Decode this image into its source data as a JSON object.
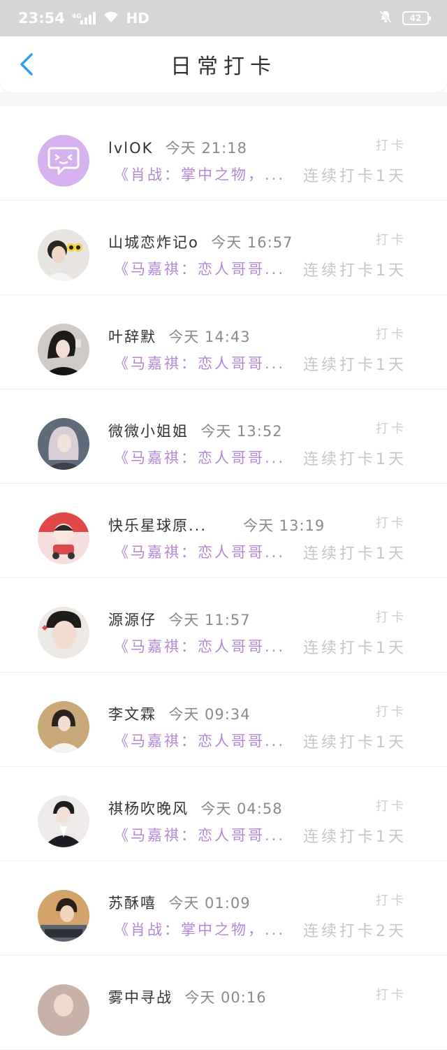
{
  "status_bar": {
    "time": "23:54",
    "network": "4G",
    "hd_label": "HD",
    "battery": "42"
  },
  "nav": {
    "title": "日常打卡",
    "accent_color": "#2b9ff5"
  },
  "colors": {
    "book_text": "#b487d6",
    "avatar_bg": "#d5b1ef"
  },
  "items": [
    {
      "name": "lvlOK",
      "time": "今天 21:18",
      "tag": "打卡",
      "book": "《肖战：掌中之物，...",
      "streak": "连续打卡1天",
      "avatar": "chat-bubble-icon"
    },
    {
      "name": "山城恋炸记o",
      "time": "今天 16:57",
      "tag": "打卡",
      "book": "《马嘉祺：恋人哥哥...",
      "streak": "连续打卡1天",
      "avatar": "photo"
    },
    {
      "name": "叶辞默",
      "time": "今天 14:43",
      "tag": "打卡",
      "book": "《马嘉祺：恋人哥哥...",
      "streak": "连续打卡1天",
      "avatar": "photo"
    },
    {
      "name": "微微小姐姐",
      "time": "今天 13:52",
      "tag": "打卡",
      "book": "《马嘉祺：恋人哥哥...",
      "streak": "连续打卡1天",
      "avatar": "photo"
    },
    {
      "name": "快乐星球原...",
      "time": "今天 13:19",
      "tag": "打卡",
      "book": "《马嘉祺：恋人哥哥...",
      "streak": "连续打卡1天",
      "avatar": "cartoon"
    },
    {
      "name": "源源仔",
      "time": "今天 11:57",
      "tag": "打卡",
      "book": "《马嘉祺：恋人哥哥...",
      "streak": "连续打卡1天",
      "avatar": "photo"
    },
    {
      "name": "李文霖",
      "time": "今天 09:34",
      "tag": "打卡",
      "book": "《马嘉祺：恋人哥哥...",
      "streak": "连续打卡1天",
      "avatar": "photo"
    },
    {
      "name": "祺杨吹晚风",
      "time": "今天 04:58",
      "tag": "打卡",
      "book": "《马嘉祺：恋人哥哥...",
      "streak": "连续打卡1天",
      "avatar": "photo"
    },
    {
      "name": "苏酥嘻",
      "time": "今天 01:09",
      "tag": "打卡",
      "book": "《肖战：掌中之物，...",
      "streak": "连续打卡2天",
      "avatar": "photo"
    },
    {
      "name": "雾中寻战",
      "time": "今天 00:16",
      "tag": "打卡",
      "book": "",
      "streak": "",
      "avatar": "photo"
    }
  ]
}
